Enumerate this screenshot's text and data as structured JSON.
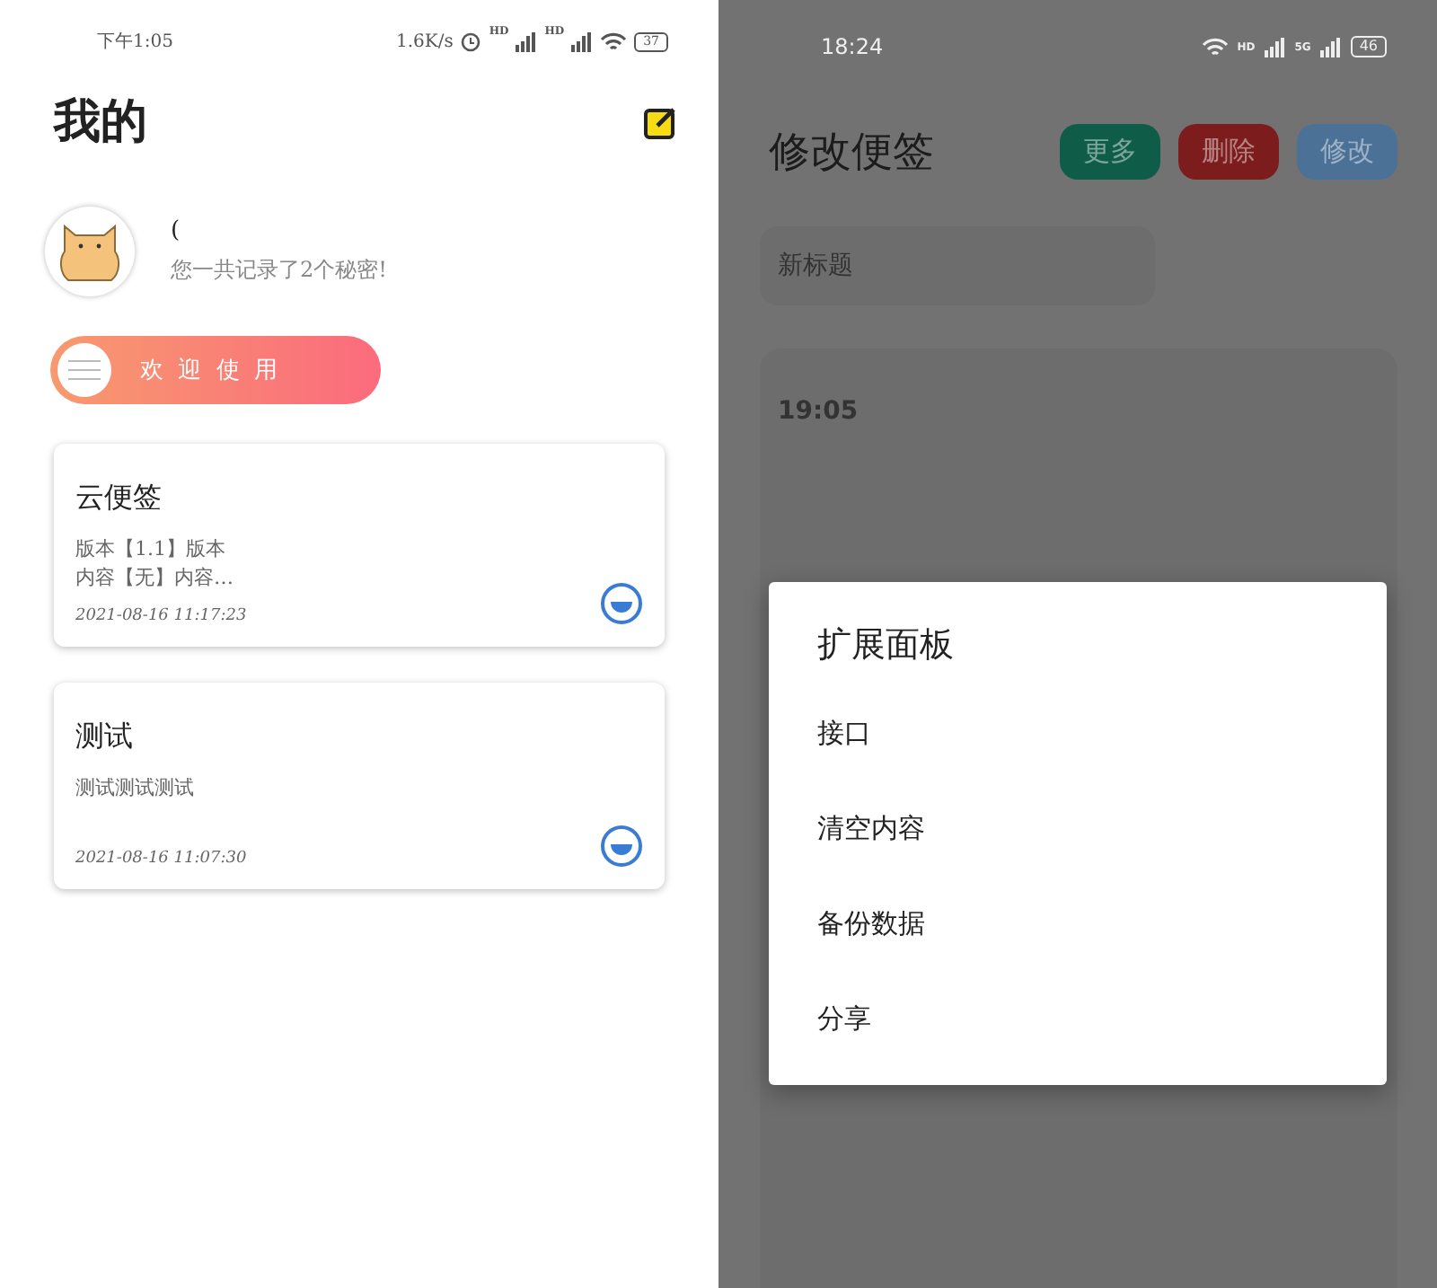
{
  "left_screen": {
    "status_bar": {
      "time": "下午1:05",
      "speed": "1.6K/s",
      "network_labels": [
        "HD",
        "HD"
      ],
      "battery": "37"
    },
    "title": "我的",
    "profile": {
      "name": "(",
      "summary": "您一共记录了2个秘密!"
    },
    "welcome_button": {
      "label": "欢 迎 使 用"
    },
    "notes": [
      {
        "title": "云便签",
        "lines": [
          "版本【1.1】版本",
          "内容【无】内容…"
        ],
        "date": "2021-08-16 11:17:23"
      },
      {
        "title": "测试",
        "lines": [
          "测试测试测试"
        ],
        "date": "2021-08-16 11:07:30"
      }
    ]
  },
  "right_screen": {
    "status_bar": {
      "time": "18:24",
      "network_labels": [
        "HD",
        "5G"
      ],
      "battery": "46"
    },
    "title": "修改便签",
    "buttons": [
      {
        "label": "更多",
        "color": "#0f5c48"
      },
      {
        "label": "删除",
        "color": "#7c1c1c"
      },
      {
        "label": "修改",
        "color": "#4b7197"
      }
    ],
    "title_field": {
      "placeholder": "新标题"
    },
    "content_time": "19:05",
    "dialog": {
      "title": "扩展面板",
      "items": [
        "接口",
        "清空内容",
        "备份数据",
        "分享"
      ]
    }
  }
}
